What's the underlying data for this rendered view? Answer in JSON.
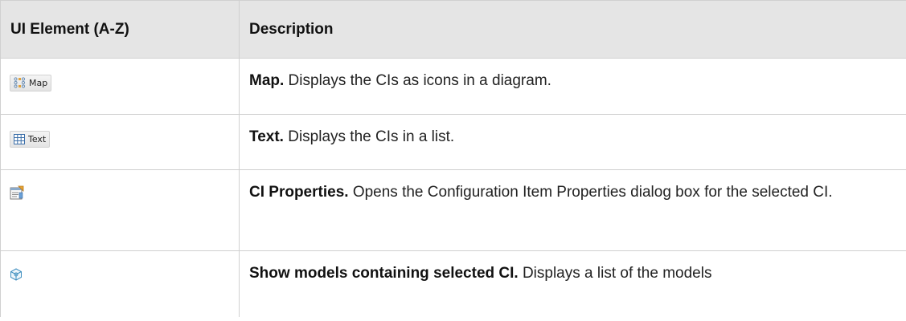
{
  "table": {
    "headers": [
      "UI Element (A-Z)",
      "Description"
    ],
    "rows": [
      {
        "element_label": "Map",
        "element_icon": "map-icon",
        "title": "Map.",
        "text": " Displays the CIs as icons in a diagram."
      },
      {
        "element_label": "Text",
        "element_icon": "grid-table-icon",
        "title": "Text.",
        "text": " Displays the CIs in a list."
      },
      {
        "element_label": "",
        "element_icon": "ci-properties-icon",
        "title": "CI Properties.",
        "text": " Opens the Configuration Item Properties dialog box for the selected CI."
      },
      {
        "element_label": "",
        "element_icon": "models-cube-icon",
        "title": "Show models containing selected CI.",
        "text": " Displays a list of the models"
      }
    ]
  }
}
